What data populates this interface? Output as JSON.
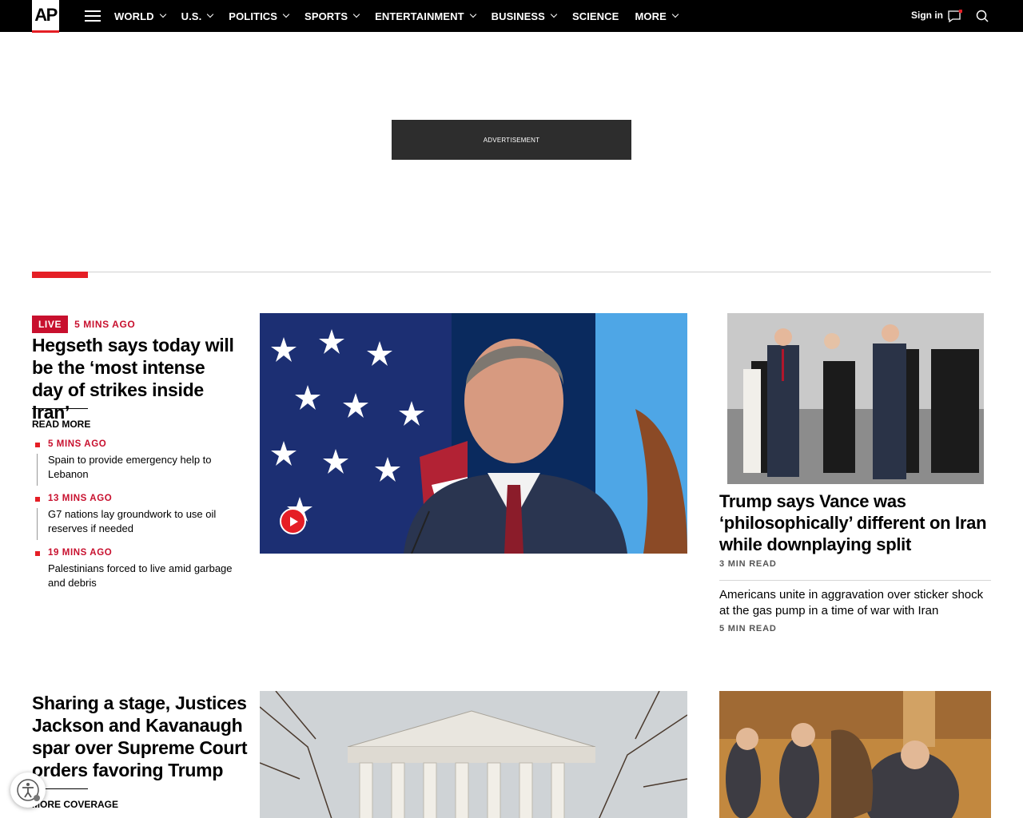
{
  "nav": {
    "logo": "AP",
    "links": [
      {
        "label": "WORLD",
        "dropdown": true
      },
      {
        "label": "U.S.",
        "dropdown": true
      },
      {
        "label": "POLITICS",
        "dropdown": true
      },
      {
        "label": "SPORTS",
        "dropdown": true
      },
      {
        "label": "ENTERTAINMENT",
        "dropdown": true
      },
      {
        "label": "BUSINESS",
        "dropdown": true
      },
      {
        "label": "SCIENCE",
        "dropdown": false
      },
      {
        "label": "MORE",
        "dropdown": true
      }
    ],
    "signin": "Sign in"
  },
  "ad": {
    "label": "ADVERTISEMENT"
  },
  "lead": {
    "badge": "LIVE",
    "time": "5 MINS AGO",
    "headline": "Hegseth says today will be the ‘most intense day of strikes inside Iran’",
    "read_more": "READ MORE",
    "updates": [
      {
        "time": "5 MINS AGO",
        "text": "Spain to provide emergency help to Lebanon"
      },
      {
        "time": "13 MINS AGO",
        "text": "G7 nations lay groundwork to use oil reserves if needed"
      },
      {
        "time": "19 MINS AGO",
        "text": "Palestinians forced to live amid garbage and debris"
      }
    ]
  },
  "right": {
    "headline": "Trump says Vance was ‘philosophically’ different on Iran while downplaying split",
    "headline_meta": "3 MIN READ",
    "sub": "Americans unite in aggravation over sticker shock at the gas pump in a time of war with Iran",
    "sub_meta": "5 MIN READ"
  },
  "second": {
    "headline": "Sharing a stage, Justices Jackson and Kavanaugh spar over Supreme Court orders favoring Trump",
    "more": "MORE COVERAGE"
  },
  "colors": {
    "accent": "#e51e25",
    "live": "#c8102e",
    "nav_bg": "#000000"
  },
  "icons": [
    "hamburger-icon",
    "chevron-down-icon",
    "chat-icon",
    "search-icon",
    "play-icon",
    "accessibility-icon"
  ]
}
